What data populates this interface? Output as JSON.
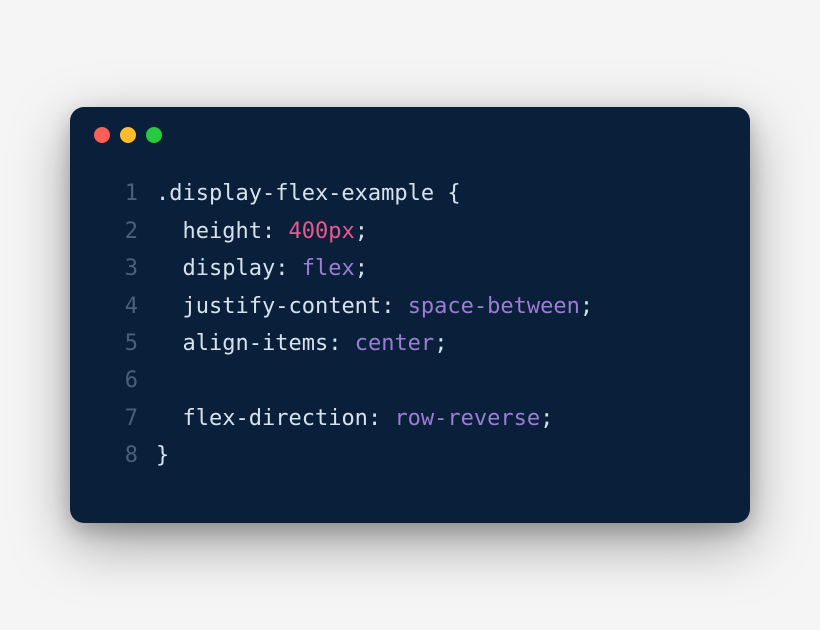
{
  "window": {
    "traffic_lights": [
      "red",
      "yellow",
      "green"
    ]
  },
  "code": {
    "lines": [
      {
        "num": "1",
        "tokens": [
          {
            "t": ".display-flex-example ",
            "c": "tok-selector"
          },
          {
            "t": "{",
            "c": "tok-punct"
          }
        ]
      },
      {
        "num": "2",
        "tokens": [
          {
            "t": "  ",
            "c": "tok-indent"
          },
          {
            "t": "height",
            "c": "tok-prop"
          },
          {
            "t": ": ",
            "c": "tok-punct"
          },
          {
            "t": "400px",
            "c": "tok-val-num"
          },
          {
            "t": ";",
            "c": "tok-punct"
          }
        ]
      },
      {
        "num": "3",
        "tokens": [
          {
            "t": "  ",
            "c": "tok-indent"
          },
          {
            "t": "display",
            "c": "tok-prop"
          },
          {
            "t": ": ",
            "c": "tok-punct"
          },
          {
            "t": "flex",
            "c": "tok-val-keyword"
          },
          {
            "t": ";",
            "c": "tok-punct"
          }
        ]
      },
      {
        "num": "4",
        "tokens": [
          {
            "t": "  ",
            "c": "tok-indent"
          },
          {
            "t": "justify-content",
            "c": "tok-prop"
          },
          {
            "t": ": ",
            "c": "tok-punct"
          },
          {
            "t": "space-between",
            "c": "tok-val-keyword"
          },
          {
            "t": ";",
            "c": "tok-punct"
          }
        ]
      },
      {
        "num": "5",
        "tokens": [
          {
            "t": "  ",
            "c": "tok-indent"
          },
          {
            "t": "align-items",
            "c": "tok-prop"
          },
          {
            "t": ": ",
            "c": "tok-punct"
          },
          {
            "t": "center",
            "c": "tok-val-keyword"
          },
          {
            "t": ";",
            "c": "tok-punct"
          }
        ]
      },
      {
        "num": "6",
        "tokens": []
      },
      {
        "num": "7",
        "tokens": [
          {
            "t": "  ",
            "c": "tok-indent"
          },
          {
            "t": "flex-direction",
            "c": "tok-prop"
          },
          {
            "t": ": ",
            "c": "tok-punct"
          },
          {
            "t": "row-reverse",
            "c": "tok-val-keyword"
          },
          {
            "t": ";",
            "c": "tok-punct"
          }
        ]
      },
      {
        "num": "8",
        "tokens": [
          {
            "t": "}",
            "c": "tok-punct"
          }
        ]
      }
    ]
  }
}
